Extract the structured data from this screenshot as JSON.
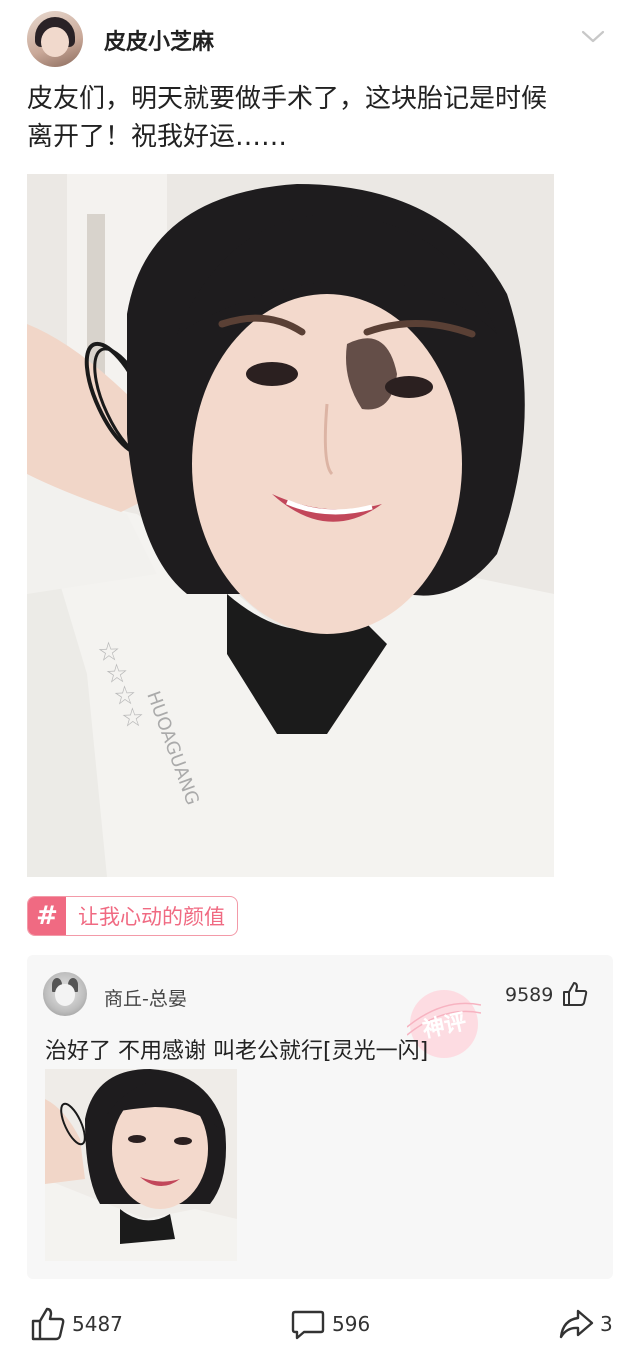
{
  "post": {
    "author": "皮皮小芝麻",
    "text_line1": "皮友们，明天就要做手术了，这块胎记是时候",
    "text_line2": "离开了！祝我好运……",
    "hashtag": "让我心动的颜值",
    "hashtag_icon": "hash-icon"
  },
  "comment": {
    "username": "商丘-总晏",
    "likes": "9589",
    "text": "治好了  不用感谢  叫老公就行[灵光一闪]",
    "stamp_text": "神评"
  },
  "actions": {
    "likes": "5487",
    "comments": "596",
    "shares": "3"
  },
  "colors": {
    "accent_pink": "#f06a82",
    "card_bg": "#f7f7f7",
    "text": "#222222"
  }
}
